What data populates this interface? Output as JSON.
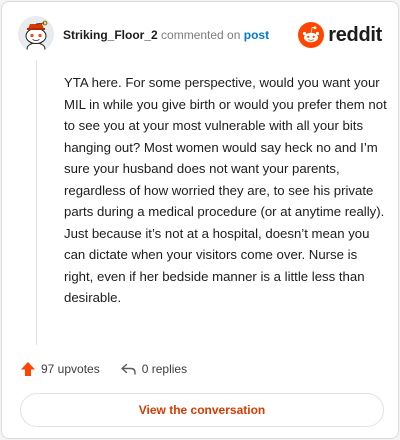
{
  "comment": {
    "author": "Striking_Floor_2",
    "action_text": "commented on",
    "target_link": "post",
    "body": "YTA here. For some perspective, would you want your MIL in while you give birth or would you prefer them not to see you at your most vulnerable with all your bits hanging out? Most women would say heck no and I’m sure your husband does not want your parents, regardless of how worried they are, to see his private parts during a medical procedure (or at anytime really). Just because it’s not at a hospital, doesn’t mean you can dictate when your visitors come over. Nurse is right, even if her bedside manner is a little less than desirable."
  },
  "brand": {
    "wordmark": "reddit",
    "logo_icon": "reddit-snoo-icon",
    "color": "#ff4500"
  },
  "stats": {
    "upvotes_label": "97 upvotes",
    "replies_label": "0 replies",
    "upvote_icon": "upvote-arrow-icon",
    "reply_icon": "reply-arrow-icon",
    "upvote_color": "#ff4500"
  },
  "cta": {
    "label": "View the conversation",
    "color": "#d93a00"
  }
}
